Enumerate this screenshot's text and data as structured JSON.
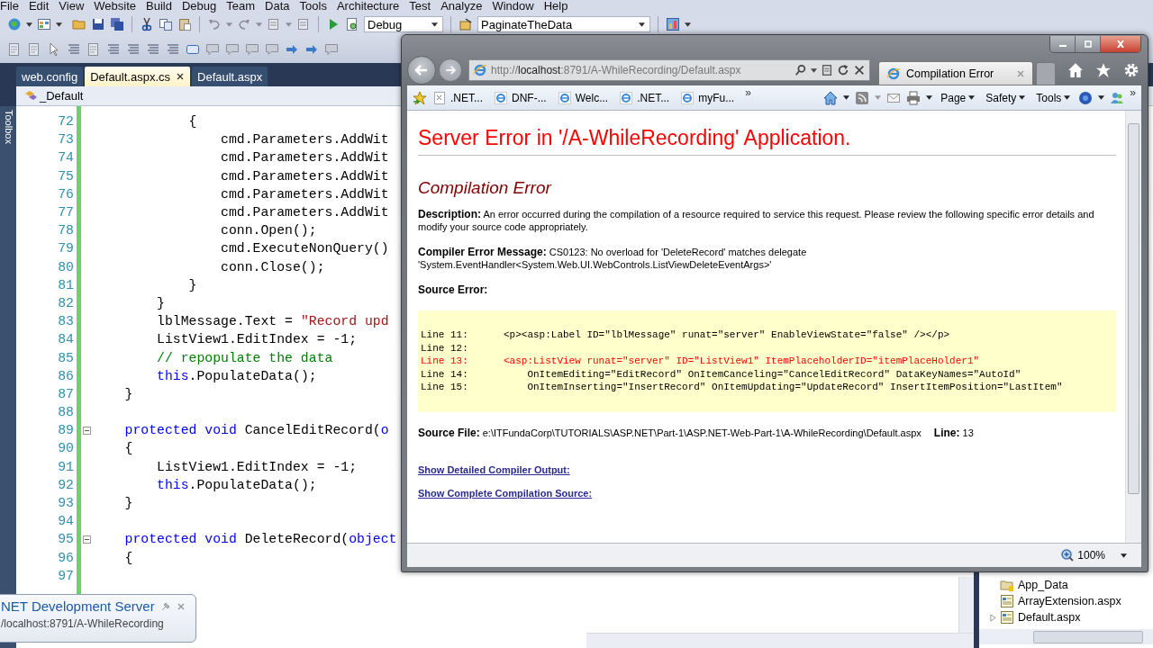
{
  "menu_bar": [
    "File",
    "Edit",
    "View",
    "Website",
    "Build",
    "Debug",
    "Team",
    "Data",
    "Tools",
    "Architecture",
    "Test",
    "Analyze",
    "Window",
    "Help"
  ],
  "toolbar": {
    "configuration": "Debug",
    "project": "PaginateTheData"
  },
  "editor_tabs": [
    {
      "label": "web.config",
      "selected": false
    },
    {
      "label": "Default.aspx.cs",
      "selected": true
    },
    {
      "label": "Default.aspx",
      "selected": false
    }
  ],
  "toolbox_label": "Toolbox",
  "class_selector": "_Default",
  "code_lines": [
    {
      "number": "72",
      "fold": false,
      "tokens": [
        {
          "kind": "plain",
          "text": "            {"
        }
      ]
    },
    {
      "number": "73",
      "fold": false,
      "tokens": [
        {
          "kind": "plain",
          "text": "                cmd.Parameters.AddWit"
        }
      ]
    },
    {
      "number": "74",
      "fold": false,
      "tokens": [
        {
          "kind": "plain",
          "text": "                cmd.Parameters.AddWit"
        }
      ]
    },
    {
      "number": "75",
      "fold": false,
      "tokens": [
        {
          "kind": "plain",
          "text": "                cmd.Parameters.AddWit"
        }
      ]
    },
    {
      "number": "76",
      "fold": false,
      "tokens": [
        {
          "kind": "plain",
          "text": "                cmd.Parameters.AddWit"
        }
      ]
    },
    {
      "number": "77",
      "fold": false,
      "tokens": [
        {
          "kind": "plain",
          "text": "                cmd.Parameters.AddWit"
        }
      ]
    },
    {
      "number": "78",
      "fold": false,
      "tokens": [
        {
          "kind": "plain",
          "text": "                conn.Open();"
        }
      ]
    },
    {
      "number": "79",
      "fold": false,
      "tokens": [
        {
          "kind": "plain",
          "text": "                cmd.ExecuteNonQuery()"
        }
      ]
    },
    {
      "number": "80",
      "fold": false,
      "tokens": [
        {
          "kind": "plain",
          "text": "                conn.Close();"
        }
      ]
    },
    {
      "number": "81",
      "fold": false,
      "tokens": [
        {
          "kind": "plain",
          "text": "            }"
        }
      ]
    },
    {
      "number": "82",
      "fold": false,
      "tokens": [
        {
          "kind": "plain",
          "text": "        }"
        }
      ]
    },
    {
      "number": "83",
      "fold": false,
      "tokens": [
        {
          "kind": "plain",
          "text": "        lblMessage.Text = "
        },
        {
          "kind": "string",
          "text": "\"Record upd"
        }
      ]
    },
    {
      "number": "84",
      "fold": false,
      "tokens": [
        {
          "kind": "plain",
          "text": "        ListView1.EditIndex = -1;"
        }
      ]
    },
    {
      "number": "85",
      "fold": false,
      "tokens": [
        {
          "kind": "comment",
          "text": "        // repopulate the data"
        }
      ]
    },
    {
      "number": "86",
      "fold": false,
      "tokens": [
        {
          "kind": "keyword",
          "text": "        this"
        },
        {
          "kind": "plain",
          "text": ".PopulateData();"
        }
      ]
    },
    {
      "number": "87",
      "fold": false,
      "tokens": [
        {
          "kind": "plain",
          "text": "    }"
        }
      ]
    },
    {
      "number": "88",
      "fold": false
    },
    {
      "number": "89",
      "fold": true,
      "tokens": [
        {
          "kind": "keyword",
          "text": "    protected void"
        },
        {
          "kind": "plain",
          "text": " CancelEditRecord("
        },
        {
          "kind": "keyword",
          "text": "o"
        }
      ]
    },
    {
      "number": "90",
      "fold": false,
      "tokens": [
        {
          "kind": "plain",
          "text": "    {"
        }
      ]
    },
    {
      "number": "91",
      "fold": false,
      "tokens": [
        {
          "kind": "plain",
          "text": "        ListView1.EditIndex = -1;"
        }
      ]
    },
    {
      "number": "92",
      "fold": false,
      "tokens": [
        {
          "kind": "keyword",
          "text": "        this"
        },
        {
          "kind": "plain",
          "text": ".PopulateData();"
        }
      ]
    },
    {
      "number": "93",
      "fold": false,
      "tokens": [
        {
          "kind": "plain",
          "text": "    }"
        }
      ]
    },
    {
      "number": "94",
      "fold": false
    },
    {
      "number": "95",
      "fold": true,
      "tokens": [
        {
          "kind": "keyword",
          "text": "    protected void"
        },
        {
          "kind": "plain",
          "text": " DeleteRecord("
        },
        {
          "kind": "keyword",
          "text": "object"
        }
      ]
    },
    {
      "number": "96",
      "fold": false,
      "tokens": [
        {
          "kind": "plain",
          "text": "    {"
        }
      ]
    },
    {
      "number": "97",
      "fold": false
    }
  ],
  "browser": {
    "url": "http://**localhost**:8791/A-WhileRecording/Default.aspx",
    "tab_title": "Compilation Error",
    "favorites": [
      ".NET...",
      "DNF-...",
      "Welc...",
      ".NET...",
      "myFu..."
    ],
    "favorites_more": "»",
    "command_more": "»",
    "commands": [
      "Page",
      "Safety",
      "Tools"
    ],
    "zoom": "100%",
    "page": {
      "title": "Server Error in '/A-WhileRecording' Application.",
      "subtitle": "Compilation Error",
      "description": "**Description:** An error occurred during the compilation of a resource required to service this request. Please review the following specific error details and modify your source code appropriately.",
      "compiler_message": "**Compiler Error Message:** CS0123: No overload for 'DeleteRecord' matches delegate 'System.EventHandler<System.Web.UI.WebControls.ListViewDeleteEventArgs>'",
      "source_error_label": "Source Error:",
      "source_lines": [
        {
          "label": "Line 11:",
          "code": "<p><asp:Label ID=\"lblMessage\" runat=\"server\" EnableViewState=\"false\" /></p>",
          "highlight": false
        },
        {
          "label": "Line 12:",
          "highlight": false
        },
        {
          "label": "Line 13:",
          "code": "<asp:ListView runat=\"server\" ID=\"ListView1\" ItemPlaceholderID=\"itemPlaceHolder1\"",
          "highlight": true
        },
        {
          "label": "Line 14:",
          "code": "    OnItemEditing=\"EditRecord\" OnItemCanceling=\"CancelEditRecord\" DataKeyNames=\"AutoId\"",
          "highlight": false
        },
        {
          "label": "Line 15:",
          "code": "    OnItemInserting=\"InsertRecord\" OnItemUpdating=\"UpdateRecord\" InsertItemPosition=\"LastItem\"",
          "highlight": false
        }
      ],
      "source_file": "**Source File:** e:\\ITFundaCorp\\TUTORIALS\\ASP.NET\\Part-1\\ASP.NET-Web-Part-1\\A-WhileRecording\\Default.aspx",
      "line_info": "**Line:** 13",
      "links": [
        "Show Detailed Compiler Output:",
        "Show Complete Compilation Source:"
      ]
    }
  },
  "solution_explorer": [
    {
      "label": "App_Data",
      "has_children": false
    },
    {
      "label": "ArrayExtension.aspx",
      "has_children": false
    },
    {
      "label": "Default.aspx",
      "has_children": true
    }
  ],
  "notification": {
    "title": "NET Development Server",
    "url": "/localhost:8791/A-WhileRecording"
  }
}
